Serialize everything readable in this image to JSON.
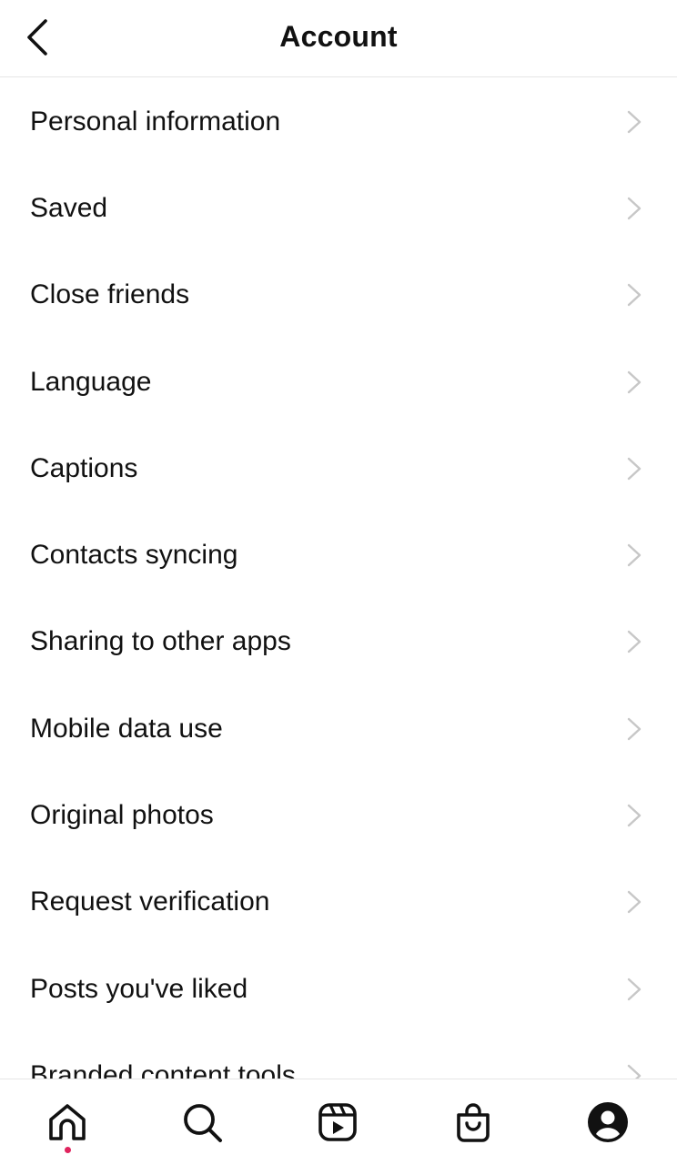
{
  "header": {
    "title": "Account",
    "back_icon": "chevron-left-icon"
  },
  "menu": {
    "items": [
      {
        "label": "Personal information"
      },
      {
        "label": "Saved"
      },
      {
        "label": "Close friends"
      },
      {
        "label": "Language"
      },
      {
        "label": "Captions"
      },
      {
        "label": "Contacts syncing"
      },
      {
        "label": "Sharing to other apps"
      },
      {
        "label": "Mobile data use"
      },
      {
        "label": "Original photos"
      },
      {
        "label": "Request verification"
      },
      {
        "label": "Posts you've liked"
      },
      {
        "label": "Branded content tools"
      }
    ],
    "chevron_icon": "chevron-right-icon"
  },
  "tabbar": {
    "tabs": [
      {
        "name": "home",
        "icon": "home-icon"
      },
      {
        "name": "search",
        "icon": "search-icon"
      },
      {
        "name": "reels",
        "icon": "reels-icon"
      },
      {
        "name": "shop",
        "icon": "shopping-bag-icon"
      },
      {
        "name": "profile",
        "icon": "profile-icon"
      }
    ],
    "notification_color": "#e0245e"
  },
  "colors": {
    "text": "#111111",
    "chevron": "#c7c7c7",
    "divider": "#e6e6e6"
  }
}
